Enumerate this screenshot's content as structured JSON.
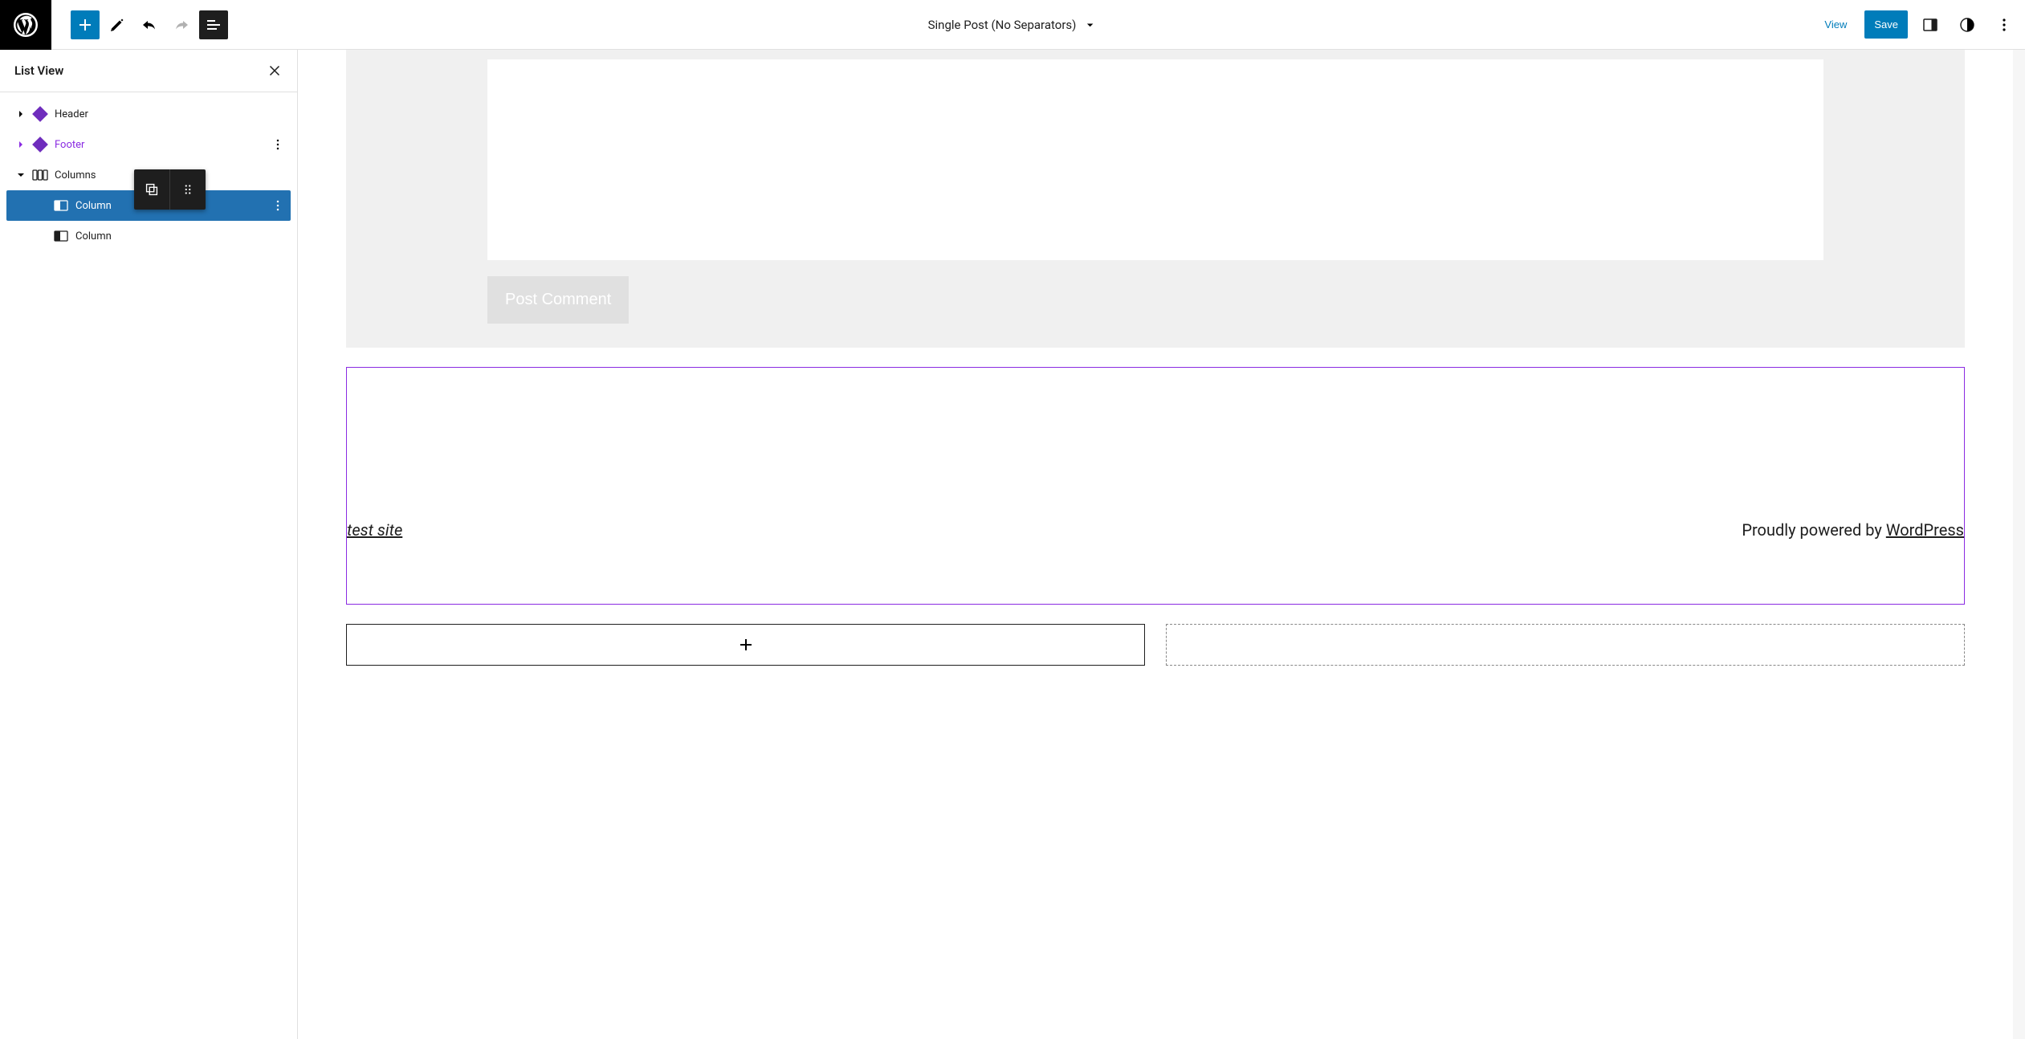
{
  "topbar": {
    "view_label": "View",
    "save_label": "Save"
  },
  "document_title": "Single Post (No Separators)",
  "listview": {
    "title": "List View",
    "items": {
      "header": "Header",
      "footer": "Footer",
      "columns": "Columns",
      "column1": "Column",
      "column2": "Column"
    }
  },
  "canvas": {
    "post_comment_label": "Post Comment",
    "site_title": "test site",
    "powered_prefix": "Proudly powered by ",
    "powered_link": "WordPress"
  }
}
